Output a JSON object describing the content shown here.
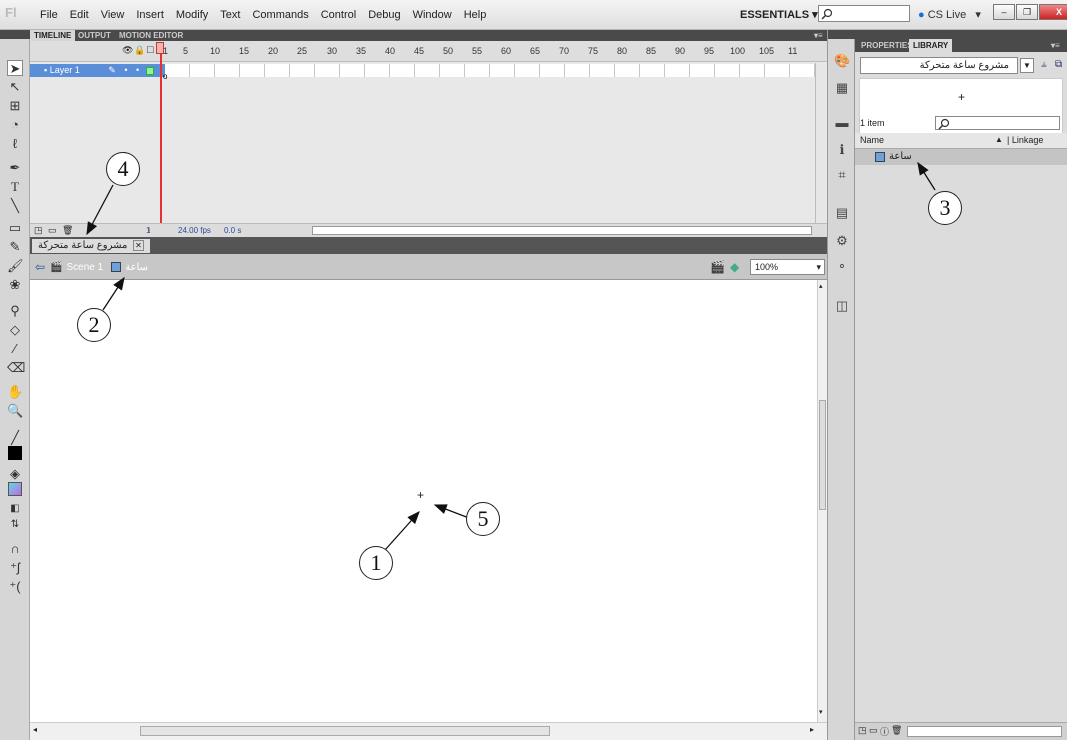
{
  "app": {
    "logo": "Fl"
  },
  "menubar": {
    "items": [
      "File",
      "Edit",
      "View",
      "Insert",
      "Modify",
      "Text",
      "Commands",
      "Control",
      "Debug",
      "Window",
      "Help"
    ],
    "workspace": "ESSENTIALS",
    "cs_live": "CS Live"
  },
  "timeline": {
    "tabs": [
      "TIMELINE",
      "OUTPUT",
      "MOTION EDITOR"
    ],
    "frame_numbers": [
      "1",
      "5",
      "10",
      "15",
      "20",
      "25",
      "30",
      "35",
      "40",
      "45",
      "50",
      "55",
      "60",
      "65",
      "70",
      "75",
      "80",
      "85",
      "90",
      "95",
      "100",
      "105",
      "11"
    ],
    "layer_name": "Layer 1",
    "current_frame": "1",
    "fps": "24.00 fps",
    "time": "0.0 s"
  },
  "document": {
    "tab_title": "مشروع ساعة متحركة"
  },
  "editbar": {
    "scene": "Scene 1",
    "symbol": "ساعة",
    "zoom": "100%"
  },
  "library": {
    "tabs": [
      "PROPERTIES",
      "LIBRARY"
    ],
    "selected_library": "مشروع ساعة متحركة",
    "item_count": "1 item",
    "col_name": "Name",
    "col_linkage": "Linkage",
    "items": [
      {
        "name": "ساعة"
      }
    ]
  },
  "callouts": [
    "1",
    "2",
    "3",
    "4",
    "5"
  ]
}
